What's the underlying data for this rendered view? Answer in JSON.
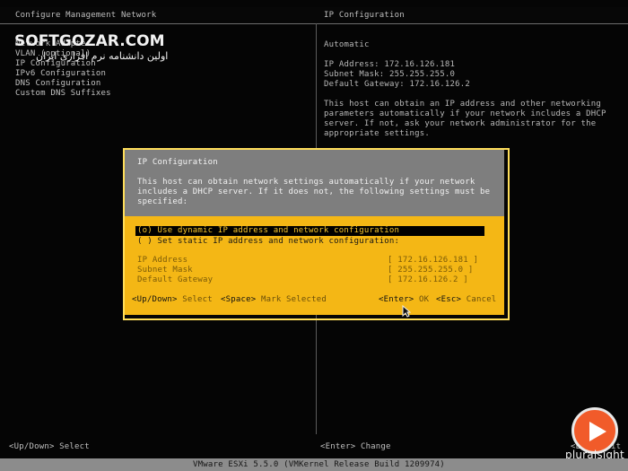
{
  "header": {
    "left_title": "Configure Management Network",
    "right_title": "IP Configuration"
  },
  "menu": {
    "items": [
      "Network Adapter",
      "VLAN (optional)",
      "IP Configuration",
      "IPv6 Configuration",
      "DNS Configuration",
      "Custom DNS Suffixes"
    ]
  },
  "right_panel": {
    "mode": "Automatic",
    "ip_address": "IP Address: 172.16.126.181",
    "subnet_mask": "Subnet Mask: 255.255.255.0",
    "default_gateway": "Default Gateway: 172.16.126.2",
    "description": "This host can obtain an IP address and other networking\nparameters automatically if your network includes a DHCP\nserver. If not, ask your network administrator for the\nappropriate settings."
  },
  "dialog": {
    "title": "IP Configuration",
    "description": "This host can obtain network settings automatically if your network\nincludes a DHCP server. If it does not, the following settings must be\nspecified:",
    "option_dhcp": "(o) Use dynamic IP address and network configuration",
    "option_static": "( ) Set static IP address and network configuration:",
    "fields": [
      {
        "label": "IP Address",
        "value": "[ 172.16.126.181   ]"
      },
      {
        "label": "Subnet Mask",
        "value": "[ 255.255.255.0    ]"
      },
      {
        "label": "Default Gateway",
        "value": "[ 172.16.126.2     ]"
      }
    ],
    "keys": {
      "updown_key": "<Up/Down>",
      "updown_label": "Select",
      "space_key": "<Space>",
      "space_label": "Mark Selected",
      "enter_key": "<Enter>",
      "enter_label": "OK",
      "esc_key": "<Esc>",
      "esc_label": "Cancel"
    }
  },
  "footer": {
    "left": "<Up/Down> Select",
    "right": "<Enter> Change",
    "esc": "<Esc> Exit",
    "status": "VMware ESXi 5.5.0 (VMKernel Release Build 1209974)"
  },
  "overlays": {
    "watermark": "SOFTGOZAR.COM",
    "watermark_sub": "اولین دانشنامه نرم افزاری ایران",
    "brand": "pluralsight",
    "brand_color": "#f15b2a"
  }
}
